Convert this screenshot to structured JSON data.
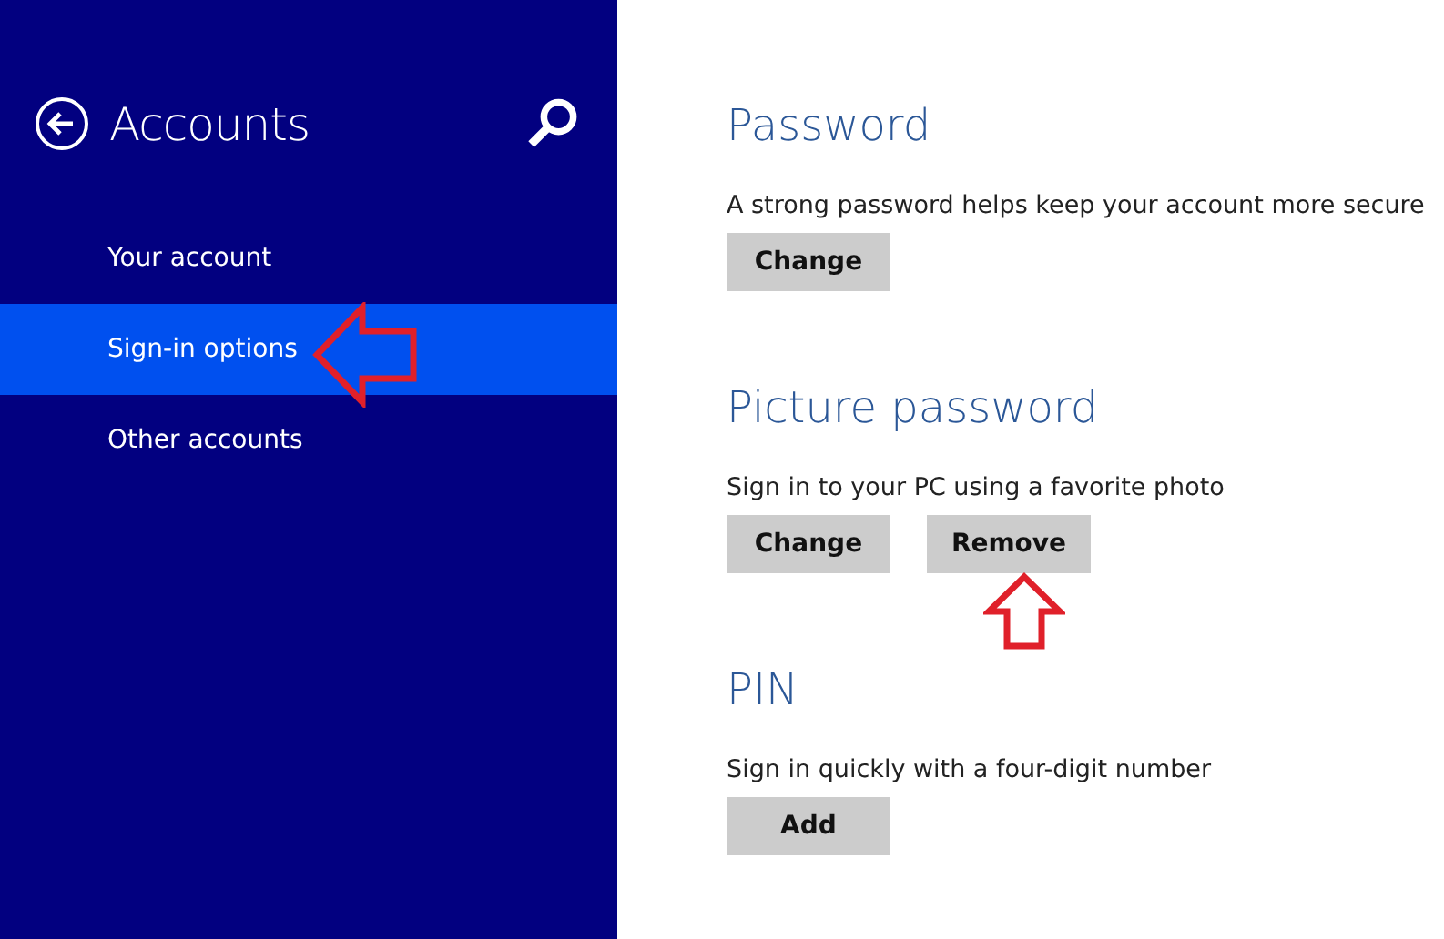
{
  "sidebar": {
    "title": "Accounts",
    "items": [
      {
        "label": "Your account",
        "selected": false
      },
      {
        "label": "Sign-in options",
        "selected": true
      },
      {
        "label": "Other accounts",
        "selected": false
      }
    ]
  },
  "sections": [
    {
      "heading": "Password",
      "description": "A strong password helps keep your account more secure",
      "buttons": [
        "Change"
      ]
    },
    {
      "heading": "Picture password",
      "description": "Sign in to your PC using a favorite photo",
      "buttons": [
        "Change",
        "Remove"
      ]
    },
    {
      "heading": "PIN",
      "description": "Sign in quickly with a four-digit number",
      "buttons": [
        "Add"
      ]
    }
  ]
}
